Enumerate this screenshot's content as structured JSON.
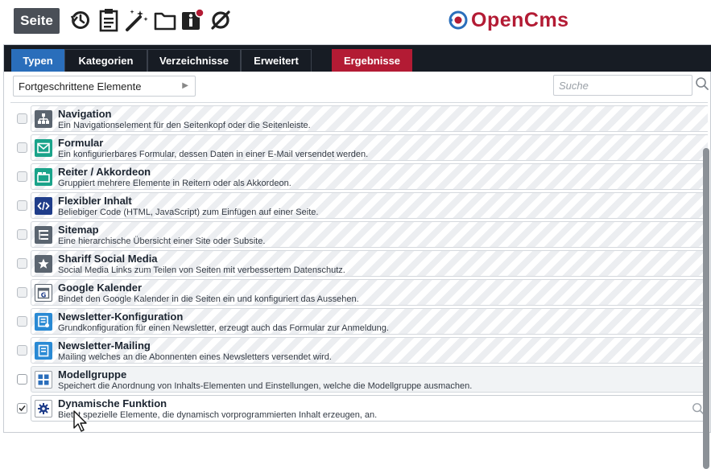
{
  "toolbar": {
    "page_button": "Seite",
    "icons": [
      "history-icon",
      "clipboard-icon",
      "magic-wand-icon",
      "folder-icon",
      "info-icon",
      "no-entry-icon"
    ],
    "logo_text": "OpenCms"
  },
  "tabs": [
    {
      "label": "Typen"
    },
    {
      "label": "Kategorien"
    },
    {
      "label": "Verzeichnisse"
    },
    {
      "label": "Erweitert"
    },
    {
      "label": "Ergebnisse"
    }
  ],
  "filter": {
    "selected": "Fortgeschrittene Elemente",
    "search_placeholder": "Suche"
  },
  "items": [
    {
      "title": "Navigation",
      "desc": "Ein Navigationselement für den Seitenkopf oder die Seitenleiste."
    },
    {
      "title": "Formular",
      "desc": "Ein konfigurierbares Formular, dessen Daten in einer E-Mail versendet werden."
    },
    {
      "title": "Reiter / Akkordeon",
      "desc": "Gruppiert mehrere Elemente in Reitern oder als Akkordeon."
    },
    {
      "title": "Flexibler Inhalt",
      "desc": "Beliebiger Code (HTML, JavaScript) zum Einfügen auf einer Seite."
    },
    {
      "title": "Sitemap",
      "desc": "Eine hierarchische Übersicht einer Site oder Subsite."
    },
    {
      "title": "Shariff Social Media",
      "desc": "Social Media Links zum Teilen von Seiten mit verbessertem Datenschutz."
    },
    {
      "title": "Google Kalender",
      "desc": "Bindet den Google Kalender in die Seiten ein und konfiguriert das Aussehen."
    },
    {
      "title": "Newsletter-Konfiguration",
      "desc": "Grundkonfiguration für einen Newsletter, erzeugt auch das Formular zur Anmeldung."
    },
    {
      "title": "Newsletter-Mailing",
      "desc": "Mailing welches an die Abonnenten eines Newsletters versendet wird."
    },
    {
      "title": "Modellgruppe",
      "desc": "Speichert die Anordnung von Inhalts-Elementen und Einstellungen, welche die Modellgruppe ausmachen."
    },
    {
      "title": "Dynamische Funktion",
      "desc": "Bietet spezielle Elemente, die dynamisch vorprogrammierten Inhalt erzeugen, an."
    }
  ],
  "colors": {
    "accent_blue": "#2a6ebb",
    "accent_red": "#b31b34",
    "tabbar_dark": "#171c24"
  }
}
